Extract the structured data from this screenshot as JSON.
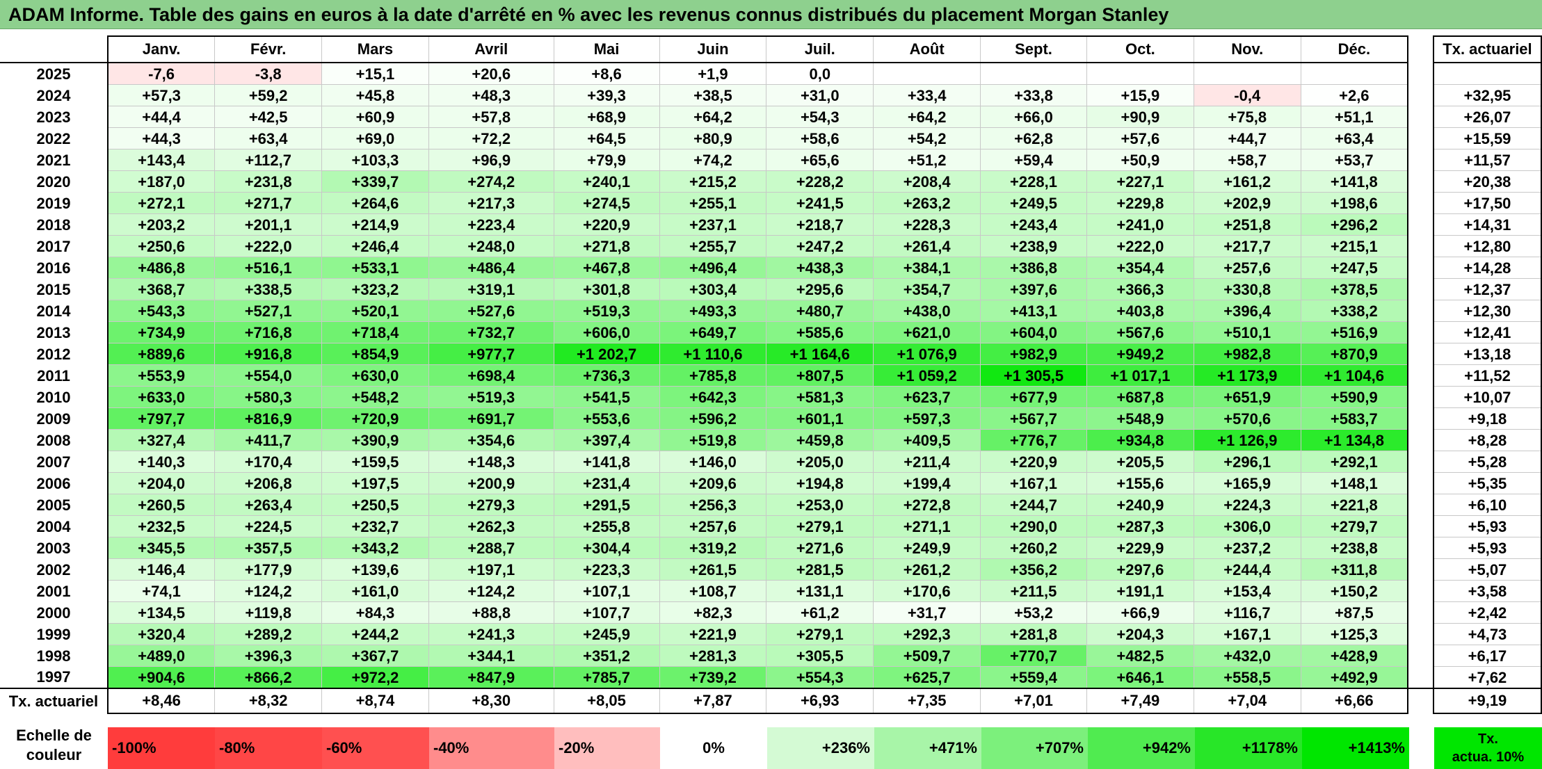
{
  "title": "ADAM Informe. Table des gains en euros à la date d'arrêté en % avec les revenus connus distribués du placement Morgan Stanley",
  "months": [
    "Janv.",
    "Févr.",
    "Mars",
    "Avril",
    "Mai",
    "Juin",
    "Juil.",
    "Août",
    "Sept.",
    "Oct.",
    "Nov.",
    "Déc."
  ],
  "tx_header": "Tx. actuariel",
  "rows": [
    {
      "year": "2025",
      "values": [
        "-7,6",
        "-3,8",
        "+15,1",
        "+20,6",
        "+8,6",
        "+1,9",
        "0,0",
        "",
        "",
        "",
        "",
        ""
      ],
      "tx": ""
    },
    {
      "year": "2024",
      "values": [
        "+57,3",
        "+59,2",
        "+45,8",
        "+48,3",
        "+39,3",
        "+38,5",
        "+31,0",
        "+33,4",
        "+33,8",
        "+15,9",
        "-0,4",
        "+2,6"
      ],
      "tx": "+32,95"
    },
    {
      "year": "2023",
      "values": [
        "+44,4",
        "+42,5",
        "+60,9",
        "+57,8",
        "+68,9",
        "+64,2",
        "+54,3",
        "+64,2",
        "+66,0",
        "+90,9",
        "+75,8",
        "+51,1"
      ],
      "tx": "+26,07"
    },
    {
      "year": "2022",
      "values": [
        "+44,3",
        "+63,4",
        "+69,0",
        "+72,2",
        "+64,5",
        "+80,9",
        "+58,6",
        "+54,2",
        "+62,8",
        "+57,6",
        "+44,7",
        "+63,4"
      ],
      "tx": "+15,59"
    },
    {
      "year": "2021",
      "values": [
        "+143,4",
        "+112,7",
        "+103,3",
        "+96,9",
        "+79,9",
        "+74,2",
        "+65,6",
        "+51,2",
        "+59,4",
        "+50,9",
        "+58,7",
        "+53,7"
      ],
      "tx": "+11,57"
    },
    {
      "year": "2020",
      "values": [
        "+187,0",
        "+231,8",
        "+339,7",
        "+274,2",
        "+240,1",
        "+215,2",
        "+228,2",
        "+208,4",
        "+228,1",
        "+227,1",
        "+161,2",
        "+141,8"
      ],
      "tx": "+20,38"
    },
    {
      "year": "2019",
      "values": [
        "+272,1",
        "+271,7",
        "+264,6",
        "+217,3",
        "+274,5",
        "+255,1",
        "+241,5",
        "+263,2",
        "+249,5",
        "+229,8",
        "+202,9",
        "+198,6"
      ],
      "tx": "+17,50"
    },
    {
      "year": "2018",
      "values": [
        "+203,2",
        "+201,1",
        "+214,9",
        "+223,4",
        "+220,9",
        "+237,1",
        "+218,7",
        "+228,3",
        "+243,4",
        "+241,0",
        "+251,8",
        "+296,2"
      ],
      "tx": "+14,31"
    },
    {
      "year": "2017",
      "values": [
        "+250,6",
        "+222,0",
        "+246,4",
        "+248,0",
        "+271,8",
        "+255,7",
        "+247,2",
        "+261,4",
        "+238,9",
        "+222,0",
        "+217,7",
        "+215,1"
      ],
      "tx": "+12,80"
    },
    {
      "year": "2016",
      "values": [
        "+486,8",
        "+516,1",
        "+533,1",
        "+486,4",
        "+467,8",
        "+496,4",
        "+438,3",
        "+384,1",
        "+386,8",
        "+354,4",
        "+257,6",
        "+247,5"
      ],
      "tx": "+14,28"
    },
    {
      "year": "2015",
      "values": [
        "+368,7",
        "+338,5",
        "+323,2",
        "+319,1",
        "+301,8",
        "+303,4",
        "+295,6",
        "+354,7",
        "+397,6",
        "+366,3",
        "+330,8",
        "+378,5"
      ],
      "tx": "+12,37"
    },
    {
      "year": "2014",
      "values": [
        "+543,3",
        "+527,1",
        "+520,1",
        "+527,6",
        "+519,3",
        "+493,3",
        "+480,7",
        "+438,0",
        "+413,1",
        "+403,8",
        "+396,4",
        "+338,2"
      ],
      "tx": "+12,30"
    },
    {
      "year": "2013",
      "values": [
        "+734,9",
        "+716,8",
        "+718,4",
        "+732,7",
        "+606,0",
        "+649,7",
        "+585,6",
        "+621,0",
        "+604,0",
        "+567,6",
        "+510,1",
        "+516,9"
      ],
      "tx": "+12,41"
    },
    {
      "year": "2012",
      "values": [
        "+889,6",
        "+916,8",
        "+854,9",
        "+977,7",
        "+1 202,7",
        "+1 110,6",
        "+1 164,6",
        "+1 076,9",
        "+982,9",
        "+949,2",
        "+982,8",
        "+870,9"
      ],
      "tx": "+13,18"
    },
    {
      "year": "2011",
      "values": [
        "+553,9",
        "+554,0",
        "+630,0",
        "+698,4",
        "+736,3",
        "+785,8",
        "+807,5",
        "+1 059,2",
        "+1 305,5",
        "+1 017,1",
        "+1 173,9",
        "+1 104,6"
      ],
      "tx": "+11,52"
    },
    {
      "year": "2010",
      "values": [
        "+633,0",
        "+580,3",
        "+548,2",
        "+519,3",
        "+541,5",
        "+642,3",
        "+581,3",
        "+623,7",
        "+677,9",
        "+687,8",
        "+651,9",
        "+590,9"
      ],
      "tx": "+10,07"
    },
    {
      "year": "2009",
      "values": [
        "+797,7",
        "+816,9",
        "+720,9",
        "+691,7",
        "+553,6",
        "+596,2",
        "+601,1",
        "+597,3",
        "+567,7",
        "+548,9",
        "+570,6",
        "+583,7"
      ],
      "tx": "+9,18"
    },
    {
      "year": "2008",
      "values": [
        "+327,4",
        "+411,7",
        "+390,9",
        "+354,6",
        "+397,4",
        "+519,8",
        "+459,8",
        "+409,5",
        "+776,7",
        "+934,8",
        "+1 126,9",
        "+1 134,8"
      ],
      "tx": "+8,28"
    },
    {
      "year": "2007",
      "values": [
        "+140,3",
        "+170,4",
        "+159,5",
        "+148,3",
        "+141,8",
        "+146,0",
        "+205,0",
        "+211,4",
        "+220,9",
        "+205,5",
        "+296,1",
        "+292,1"
      ],
      "tx": "+5,28"
    },
    {
      "year": "2006",
      "values": [
        "+204,0",
        "+206,8",
        "+197,5",
        "+200,9",
        "+231,4",
        "+209,6",
        "+194,8",
        "+199,4",
        "+167,1",
        "+155,6",
        "+165,9",
        "+148,1"
      ],
      "tx": "+5,35"
    },
    {
      "year": "2005",
      "values": [
        "+260,5",
        "+263,4",
        "+250,5",
        "+279,3",
        "+291,5",
        "+256,3",
        "+253,0",
        "+272,8",
        "+244,7",
        "+240,9",
        "+224,3",
        "+221,8"
      ],
      "tx": "+6,10"
    },
    {
      "year": "2004",
      "values": [
        "+232,5",
        "+224,5",
        "+232,7",
        "+262,3",
        "+255,8",
        "+257,6",
        "+279,1",
        "+271,1",
        "+290,0",
        "+287,3",
        "+306,0",
        "+279,7"
      ],
      "tx": "+5,93"
    },
    {
      "year": "2003",
      "values": [
        "+345,5",
        "+357,5",
        "+343,2",
        "+288,7",
        "+304,4",
        "+319,2",
        "+271,6",
        "+249,9",
        "+260,2",
        "+229,9",
        "+237,2",
        "+238,8"
      ],
      "tx": "+5,93"
    },
    {
      "year": "2002",
      "values": [
        "+146,4",
        "+177,9",
        "+139,6",
        "+197,1",
        "+223,3",
        "+261,5",
        "+281,5",
        "+261,2",
        "+356,2",
        "+297,6",
        "+244,4",
        "+311,8"
      ],
      "tx": "+5,07"
    },
    {
      "year": "2001",
      "values": [
        "+74,1",
        "+124,2",
        "+161,0",
        "+124,2",
        "+107,1",
        "+108,7",
        "+131,1",
        "+170,6",
        "+211,5",
        "+191,1",
        "+153,4",
        "+150,2"
      ],
      "tx": "+3,58"
    },
    {
      "year": "2000",
      "values": [
        "+134,5",
        "+119,8",
        "+84,3",
        "+88,8",
        "+107,7",
        "+82,3",
        "+61,2",
        "+31,7",
        "+53,2",
        "+66,9",
        "+116,7",
        "+87,5"
      ],
      "tx": "+2,42"
    },
    {
      "year": "1999",
      "values": [
        "+320,4",
        "+289,2",
        "+244,2",
        "+241,3",
        "+245,9",
        "+221,9",
        "+279,1",
        "+292,3",
        "+281,8",
        "+204,3",
        "+167,1",
        "+125,3"
      ],
      "tx": "+4,73"
    },
    {
      "year": "1998",
      "values": [
        "+489,0",
        "+396,3",
        "+367,7",
        "+344,1",
        "+351,2",
        "+281,3",
        "+305,5",
        "+509,7",
        "+770,7",
        "+482,5",
        "+432,0",
        "+428,9"
      ],
      "tx": "+6,17"
    },
    {
      "year": "1997",
      "values": [
        "+904,6",
        "+866,2",
        "+972,2",
        "+847,9",
        "+785,7",
        "+739,2",
        "+554,3",
        "+625,7",
        "+559,4",
        "+646,1",
        "+558,5",
        "+492,9"
      ],
      "tx": "+7,62"
    }
  ],
  "totals": {
    "label": "Tx. actuariel",
    "values": [
      "+8,46",
      "+8,32",
      "+8,74",
      "+8,30",
      "+8,05",
      "+7,87",
      "+6,93",
      "+7,35",
      "+7,01",
      "+7,49",
      "+7,04",
      "+6,66"
    ],
    "tx": "+9,19"
  },
  "legend": {
    "label_line1": "Echelle de",
    "label_line2": "couleur",
    "items": [
      {
        "label": "-100%",
        "color": "#ff3c3c",
        "align": "l"
      },
      {
        "label": "-80%",
        "color": "#ff4646",
        "align": "l"
      },
      {
        "label": "-60%",
        "color": "#ff5050",
        "align": "l"
      },
      {
        "label": "-40%",
        "color": "#ff8c8c",
        "align": "l"
      },
      {
        "label": "-20%",
        "color": "#ffbebe",
        "align": "l"
      },
      {
        "label": "0%",
        "color": "#ffffff",
        "align": "c"
      },
      {
        "label": "+236%",
        "color": "#d4fad4",
        "align": "r"
      },
      {
        "label": "+471%",
        "color": "#a8f5a8",
        "align": "r"
      },
      {
        "label": "+707%",
        "color": "#7cf07c",
        "align": "r"
      },
      {
        "label": "+942%",
        "color": "#50eb50",
        "align": "r"
      },
      {
        "label": "+1178%",
        "color": "#28e628",
        "align": "r"
      },
      {
        "label": "+1413%",
        "color": "#00e600",
        "align": "r"
      }
    ],
    "tx_line1": "Tx.",
    "tx_line2": "actua. 10%"
  }
}
